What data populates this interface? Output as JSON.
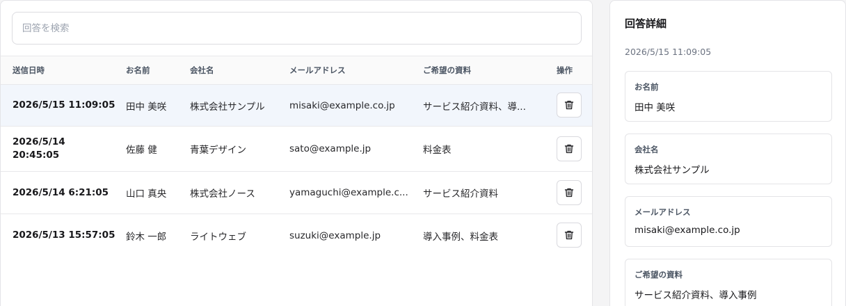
{
  "search": {
    "placeholder": "回答を検索"
  },
  "table": {
    "headers": {
      "date": "送信日時",
      "name": "お名前",
      "company": "会社名",
      "email": "メールアドレス",
      "materials": "ご希望の資料",
      "actions": "操作"
    },
    "rows": [
      {
        "date": "2026/5/15 11:09:05",
        "name": "田中 美咲",
        "company": "株式会社サンプル",
        "email": "misaki@example.co.jp",
        "materials": "サービス紹介資料、導...",
        "selected": true
      },
      {
        "date": "2026/5/14 20:45:05",
        "name": "佐藤 健",
        "company": "青葉デザイン",
        "email": "sato@example.jp",
        "materials": "料金表",
        "selected": false
      },
      {
        "date": "2026/5/14 6:21:05",
        "name": "山口 真央",
        "company": "株式会社ノース",
        "email": "yamaguchi@example.c...",
        "materials": "サービス紹介資料",
        "selected": false
      },
      {
        "date": "2026/5/13 15:57:05",
        "name": "鈴木 一郎",
        "company": "ライトウェブ",
        "email": "suzuki@example.jp",
        "materials": "導入事例、料金表",
        "selected": false
      }
    ],
    "row_action_icon": "trash-icon"
  },
  "detail": {
    "title": "回答詳細",
    "timestamp": "2026/5/15 11:09:05",
    "fields": [
      {
        "label": "お名前",
        "value": "田中 美咲"
      },
      {
        "label": "会社名",
        "value": "株式会社サンプル"
      },
      {
        "label": "メールアドレス",
        "value": "misaki@example.co.jp"
      },
      {
        "label": "ご希望の資料",
        "value": "サービス紹介資料、導入事例"
      }
    ]
  },
  "colors": {
    "selected_row": "#f2f6fc",
    "border": "#e4e4e7",
    "page_background": "#f4f4f5"
  }
}
